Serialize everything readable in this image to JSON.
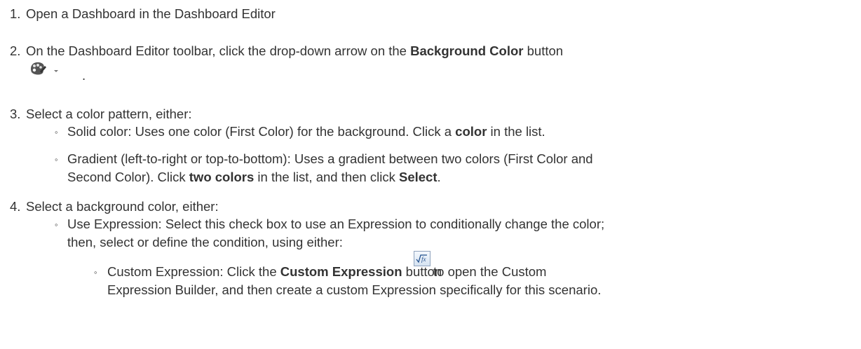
{
  "steps": [
    {
      "number": "1.",
      "text": "Open a Dashboard in the Dashboard Editor"
    },
    {
      "number": "2.",
      "text_before": "On the Dashboard Editor toolbar, click the drop-down arrow on the ",
      "bold": "Background Color",
      "text_after": " button",
      "icon": "palette-dropdown-icon",
      "trailing": "."
    },
    {
      "number": "3.",
      "text": "Select a color pattern, either:",
      "bullets": [
        {
          "marker": "◦",
          "before": "Solid color: Uses one color (First Color) for the background. Click a ",
          "bold": "color",
          "after": " in the list."
        },
        {
          "marker": "◦",
          "line1": "Gradient (left-to-right or top-to-bottom): Uses a gradient between two colors (First Color and",
          "line2_before": "Second Color). Click ",
          "line2_bold1": "two colors",
          "line2_mid": " in the list, and then click ",
          "line2_bold2": "Select",
          "line2_after": "."
        }
      ]
    },
    {
      "number": "4.",
      "text": "Select a background color, either:",
      "bullets": [
        {
          "marker": "◦",
          "line1": "Use Expression: Select this check box to use an Expression to conditionally change the color;",
          "line2": "then, select or define the condition, using either:",
          "sub_bullets": [
            {
              "marker": "◦",
              "before": "Custom Expression: Click the ",
              "bold": "Custom Expression",
              "after_button_text": " button",
              "icon": "custom-expression-icon",
              "after_icon": " to open the Custom",
              "line2": "Expression Builder, and then create a custom Expression specifically for this scenario."
            }
          ]
        }
      ]
    }
  ]
}
